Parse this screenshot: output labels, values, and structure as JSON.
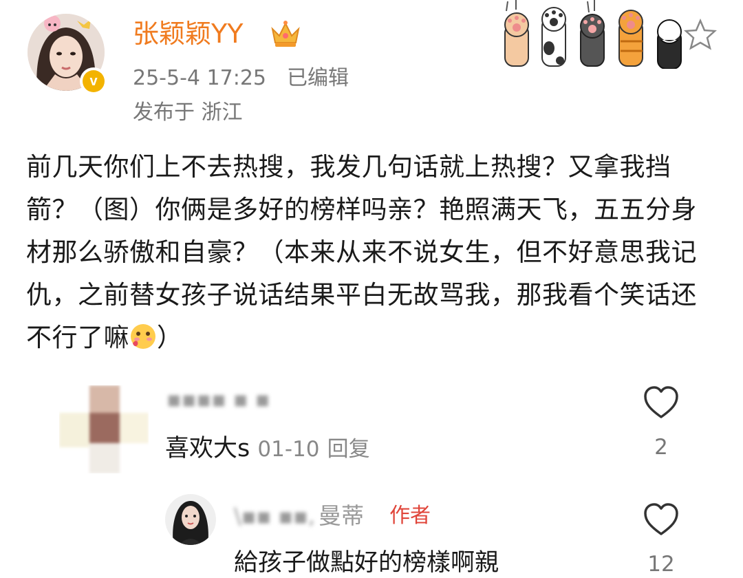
{
  "post": {
    "username": "张颖颖YY",
    "date": "25-5-4 17:25",
    "edited_label": "已编辑",
    "location": "发布于 浙江",
    "text": "前几天你们上不去热搜，我发几句话就上热搜？又拿我挡箭？（图）你俩是多好的榜样吗亲？艳照满天飞，五五分身材那么骄傲和自豪？（本来从来不说女生，但不好意思我记仇，之前替女孩子说话结果平白无故骂我，那我看个笑话还不行了嘛",
    "text_end": "）",
    "verified_glyph": "v"
  },
  "comments": [
    {
      "name_blurred": "▪▪▪▪ ▪ ▪",
      "text": "喜欢大s",
      "time": "01-10",
      "reply_label": "回复",
      "likes": "2"
    },
    {
      "name_blurred": "\\▪▪ ▪▪,",
      "name_visible": "曼蒂",
      "author_badge": "作者",
      "text": "給孩子做點好的榜樣啊親",
      "likes": "12"
    }
  ],
  "colors": {
    "username": "#f07b1f",
    "author_badge": "#e0453a",
    "meta_gray": "#777777"
  },
  "icons": [
    "avatar",
    "verified-badge-icon",
    "crown-icon",
    "cat-paw-decoration",
    "star-icon",
    "shy-face-emoji-icon",
    "heart-outline-icon"
  ]
}
